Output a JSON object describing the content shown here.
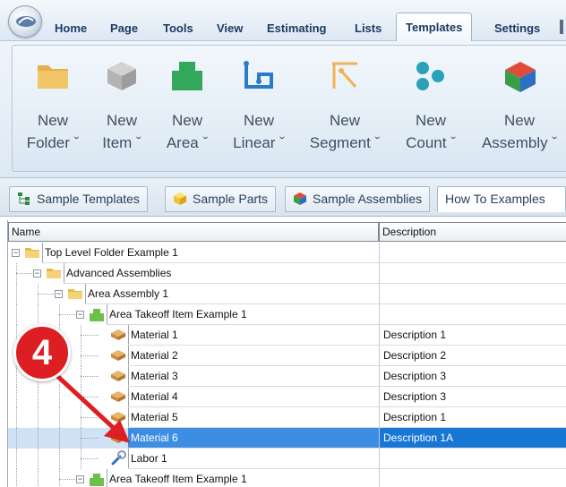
{
  "menu": {
    "tabs": [
      "Home",
      "Page",
      "Tools",
      "View",
      "Estimating",
      "Lists",
      "Templates",
      "Settings"
    ],
    "active": "Templates"
  },
  "ribbon": {
    "buttons": [
      {
        "line1": "New",
        "line2": "Folder ˇ",
        "icon": "folder-icon",
        "color": "#e3b04b"
      },
      {
        "line1": "New",
        "line2": "Item ˇ",
        "icon": "cube-icon",
        "color": "#b8b8b8"
      },
      {
        "line1": "New",
        "line2": "Area ˇ",
        "icon": "area-shape-icon",
        "color": "#33a85a"
      },
      {
        "line1": "New",
        "line2": "Linear ˇ",
        "icon": "linear-icon",
        "color": "#2c7bc9"
      },
      {
        "line1": "New",
        "line2": "Segment ˇ",
        "icon": "segment-icon",
        "color": "#f0b257"
      },
      {
        "line1": "New",
        "line2": "Count ˇ",
        "icon": "count-dots-icon",
        "color": "#2aa1b8"
      },
      {
        "line1": "New",
        "line2": "Assembly ˇ",
        "icon": "assembly-cube-icon",
        "color": "#e24b3a"
      }
    ]
  },
  "doc_tabs": [
    {
      "label": "Sample Templates",
      "icon": "templates-tree-icon"
    },
    {
      "label": "Sample Parts",
      "icon": "parts-cube-icon"
    },
    {
      "label": "Sample Assemblies",
      "icon": "assembly-cube-icon"
    },
    {
      "label": "How To Examples",
      "icon": ""
    }
  ],
  "grid": {
    "columns": {
      "name": "Name",
      "description": "Description"
    },
    "rows": [
      {
        "name": "Top Level Folder Example 1",
        "description": "",
        "type": "folder",
        "level": 0,
        "expander": "−"
      },
      {
        "name": "Advanced Assemblies",
        "description": "",
        "type": "folder",
        "level": 1,
        "expander": "−"
      },
      {
        "name": "Area Assembly 1",
        "description": "",
        "type": "folder",
        "level": 2,
        "expander": "−"
      },
      {
        "name": "Area Takeoff Item Example 1",
        "description": "",
        "type": "area",
        "level": 3,
        "expander": "−"
      },
      {
        "name": "Material 1",
        "description": "Description 1",
        "type": "material",
        "level": 4,
        "expander": ""
      },
      {
        "name": "Material 2",
        "description": "Description 2",
        "type": "material",
        "level": 4,
        "expander": ""
      },
      {
        "name": "Material 3",
        "description": "Description 3",
        "type": "material",
        "level": 4,
        "expander": ""
      },
      {
        "name": "Material 4",
        "description": "Description 3",
        "type": "material",
        "level": 4,
        "expander": ""
      },
      {
        "name": "Material 5",
        "description": "Description 1",
        "type": "material",
        "level": 4,
        "expander": ""
      },
      {
        "name": "Material 6",
        "description": "Description 1A",
        "type": "material",
        "level": 4,
        "expander": "",
        "selected": true
      },
      {
        "name": "Labor 1",
        "description": "",
        "type": "labor",
        "level": 4,
        "expander": ""
      },
      {
        "name": "Area Takeoff Item Example 1",
        "description": "",
        "type": "area",
        "level": 3,
        "expander": "−"
      }
    ]
  },
  "callout": {
    "number": "4",
    "color": "#dd1e22"
  },
  "colors": {
    "selection": "#1877d4",
    "accent": "#1e3a63"
  }
}
